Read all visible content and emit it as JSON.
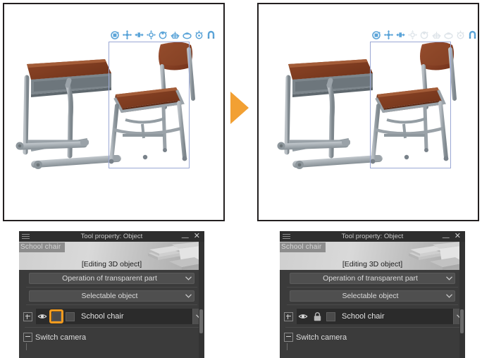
{
  "figure": {
    "arrow_color": "#f2a033",
    "frame_border_color": "#231f20"
  },
  "viewports": [
    {
      "id": "before",
      "caption": "",
      "objects": [
        "school-desk",
        "school-chair"
      ],
      "selection": {
        "target": "school-chair",
        "border_color": "#9aa7d4"
      },
      "gizmo": {
        "icons": [
          {
            "name": "rotate-object-icon",
            "enabled": true
          },
          {
            "name": "move-object-icon",
            "enabled": true
          },
          {
            "name": "move-depth-icon",
            "enabled": true
          },
          {
            "name": "move-root-icon",
            "enabled": true
          },
          {
            "name": "rotate-part-icon",
            "enabled": true
          },
          {
            "name": "rotate-camera-icon",
            "enabled": true
          },
          {
            "name": "pan-camera-icon",
            "enabled": true
          },
          {
            "name": "zoom-camera-icon",
            "enabled": true
          },
          {
            "name": "magnet-snap-icon",
            "enabled": true
          }
        ],
        "active_color": "#5ba4d8",
        "disabled_color": "#cfd9e2"
      }
    },
    {
      "id": "after",
      "caption": "",
      "objects": [
        "school-desk",
        "school-chair"
      ],
      "selection": {
        "target": "school-chair",
        "border_color": "#9aa7d4"
      },
      "gizmo": {
        "icons": [
          {
            "name": "rotate-object-icon",
            "enabled": true
          },
          {
            "name": "move-object-icon",
            "enabled": true
          },
          {
            "name": "move-depth-icon",
            "enabled": true
          },
          {
            "name": "move-root-icon",
            "enabled": false
          },
          {
            "name": "rotate-part-icon",
            "enabled": false
          },
          {
            "name": "rotate-camera-icon",
            "enabled": false
          },
          {
            "name": "pan-camera-icon",
            "enabled": false
          },
          {
            "name": "zoom-camera-icon",
            "enabled": false
          },
          {
            "name": "magnet-snap-icon",
            "enabled": true
          }
        ],
        "active_color": "#5ba4d8",
        "disabled_color": "#cfd9e2"
      }
    }
  ],
  "panels": [
    {
      "id": "before",
      "title": "Tool property: Object",
      "minimize_label": "—",
      "close_label": "✕",
      "preview": {
        "object_chip": "School chair",
        "status": "[Editing 3D object]"
      },
      "dropdowns": [
        {
          "label": "Operation of transparent part"
        },
        {
          "label": "Selectable object"
        }
      ],
      "object_row": {
        "expander": "+",
        "eye_icon": "visibility-eye-icon",
        "lock_state": "unlocked",
        "lock_highlighted": true,
        "highlight_color": "#f59b1e",
        "checkbox_checked": false,
        "name": "School chair"
      },
      "tree": {
        "expander": "-",
        "label": "Switch camera"
      }
    },
    {
      "id": "after",
      "title": "Tool property: Object",
      "minimize_label": "—",
      "close_label": "✕",
      "preview": {
        "object_chip": "School chair",
        "status": "[Editing 3D object]"
      },
      "dropdowns": [
        {
          "label": "Operation of transparent part"
        },
        {
          "label": "Selectable object"
        }
      ],
      "object_row": {
        "expander": "+",
        "eye_icon": "visibility-eye-icon",
        "lock_state": "locked",
        "lock_highlighted": false,
        "highlight_color": "#f59b1e",
        "checkbox_checked": false,
        "name": "School chair"
      },
      "tree": {
        "expander": "-",
        "label": "Switch camera"
      }
    }
  ]
}
